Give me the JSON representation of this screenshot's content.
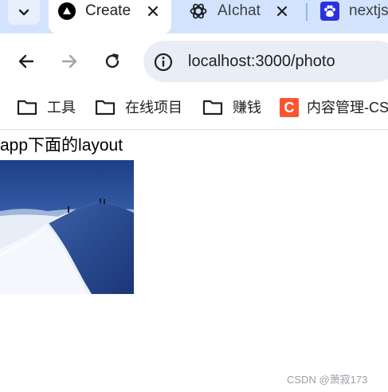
{
  "browser": {
    "tabs": [
      {
        "title": "Create",
        "active": true,
        "icon": "nextjs-logo-icon"
      },
      {
        "title": "AIchat",
        "active": false,
        "icon": "openai-logo-icon"
      },
      {
        "title": "nextjs",
        "active": false,
        "icon": "baidu-logo-icon"
      }
    ],
    "toolbar": {
      "url": "localhost:3000/photo"
    },
    "bookmarks": [
      {
        "label": "工具",
        "icon": "folder-icon"
      },
      {
        "label": "在线项目",
        "icon": "folder-icon"
      },
      {
        "label": "赚钱",
        "icon": "folder-icon"
      },
      {
        "label": "内容管理-CS",
        "icon": "csdn-logo-icon",
        "icon_text": "C"
      }
    ]
  },
  "page": {
    "heading": "app下面的layout",
    "image": {
      "icon": "mountain-photo"
    }
  },
  "watermark": "CSDN @萧寂173",
  "colors": {
    "tab_strip": "#d3e3fd",
    "omnibox": "#e9eef6",
    "csdn_brand": "#fc5531",
    "baidu_brand": "#2932e1"
  }
}
